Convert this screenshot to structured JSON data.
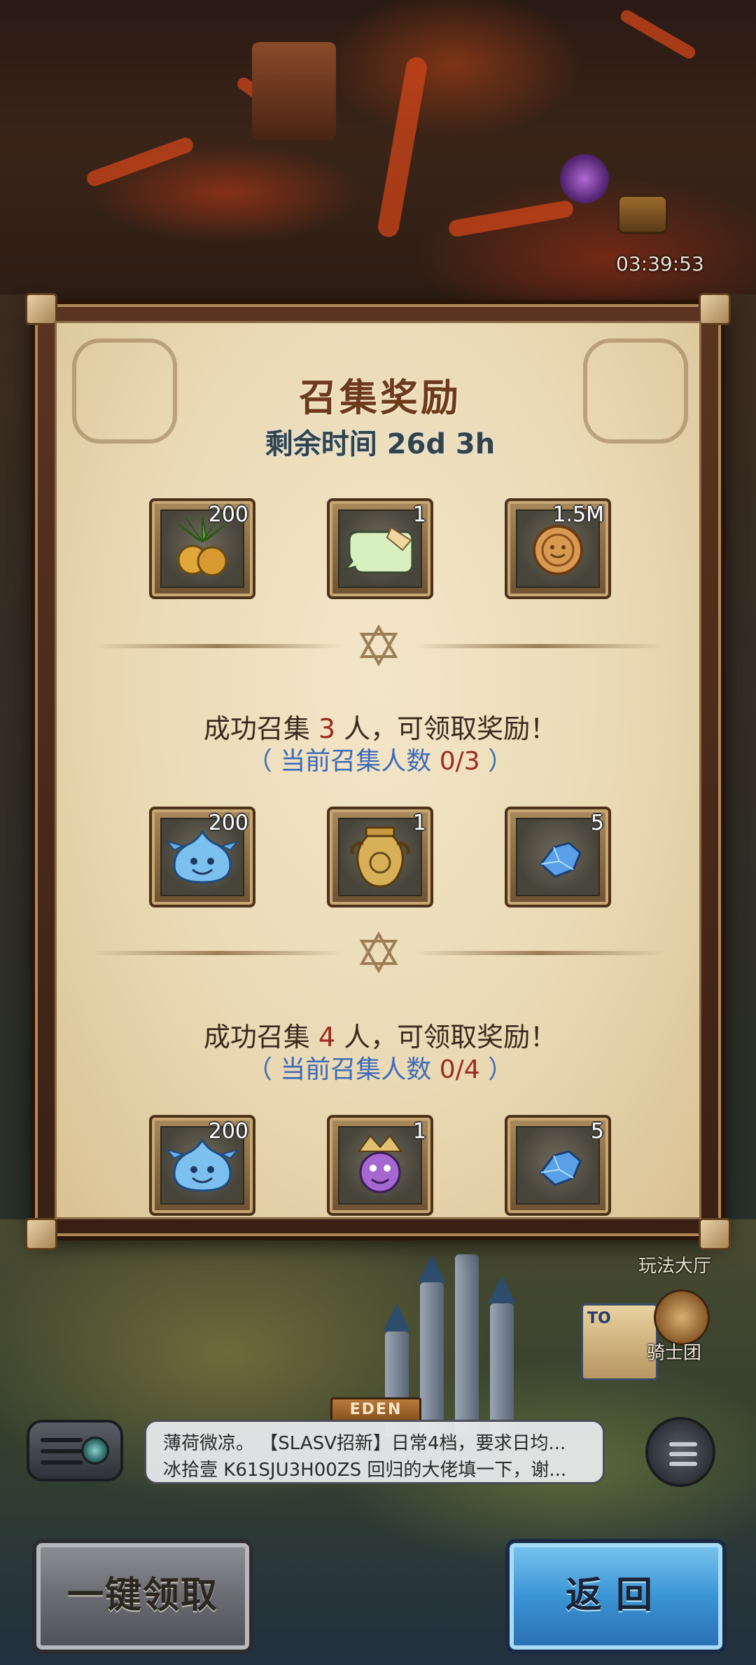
{
  "status": {
    "timer": "03:39:53"
  },
  "panel": {
    "title": "召集奖励",
    "subtitle": "剩余时间 26d 3h",
    "rewards_top": [
      {
        "icon": "fruit-plant-icon",
        "count": "200"
      },
      {
        "icon": "speech-ticket-icon",
        "count": "1"
      },
      {
        "icon": "gold-coin-icon",
        "count": "1.5M"
      }
    ],
    "tiers": [
      {
        "req_prefix": "成功召集 ",
        "req_num": "3",
        "req_suffix": " 人，可领取奖励！",
        "cur_prefix": "（ 当前召集人数 ",
        "cur_value": "0/3",
        "cur_suffix": " ）",
        "rewards": [
          {
            "icon": "blue-slime-icon",
            "count": "200"
          },
          {
            "icon": "golden-urn-icon",
            "count": "1"
          },
          {
            "icon": "blue-crystal-icon",
            "count": "5"
          }
        ]
      },
      {
        "req_prefix": "成功召集 ",
        "req_num": "4",
        "req_suffix": " 人，可领取奖励！",
        "cur_prefix": "（ 当前召集人数 ",
        "cur_value": "0/4",
        "cur_suffix": " ）",
        "rewards": [
          {
            "icon": "blue-slime-icon",
            "count": "200"
          },
          {
            "icon": "purple-hero-portrait-icon",
            "count": "1"
          },
          {
            "icon": "blue-crystal-icon",
            "count": "5"
          }
        ]
      }
    ]
  },
  "side": {
    "play_hall": "玩法大厅",
    "knights": "骑士团",
    "event_tag": "TO"
  },
  "map": {
    "eden": "EDEN"
  },
  "chat": {
    "line1": "薄荷微凉。 【SLASV招新】日常4档，要求日均...",
    "line2": "冰拾壹  K61SJU3H00ZS  回归的大佬填一下，谢..."
  },
  "buttons": {
    "claim_all": "一键领取",
    "back": "返回"
  },
  "colors": {
    "accent_red": "#9c2a1e",
    "accent_blue": "#3e6bb8",
    "title_brown": "#6e3a1e"
  }
}
